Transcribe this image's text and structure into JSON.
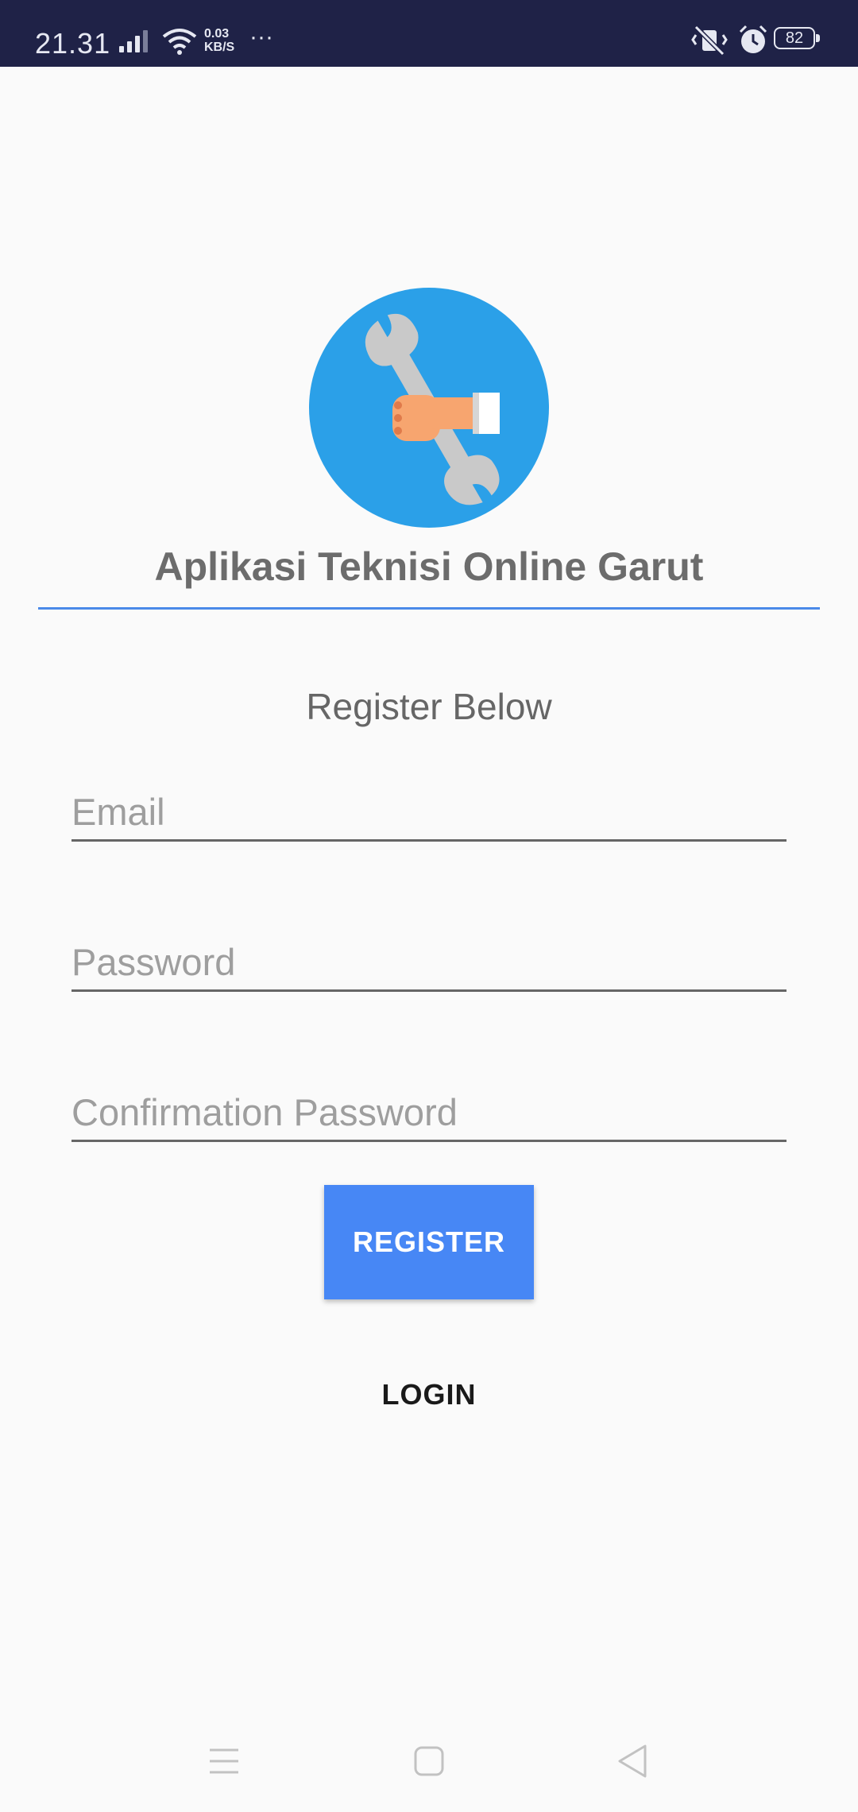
{
  "status_bar": {
    "time": "21.31",
    "net_speed_value": "0.03",
    "net_speed_unit": "KB/S",
    "more": "···",
    "battery": "82",
    "icons": [
      "signal-icon",
      "wifi-icon",
      "mute-icon",
      "alarm-icon",
      "battery-icon"
    ]
  },
  "header": {
    "logo_icon": "wrench-hand-logo",
    "title": "Aplikasi Teknisi Online Garut"
  },
  "form": {
    "heading": "Register Below",
    "email_placeholder": "Email",
    "password_placeholder": "Password",
    "confirm_placeholder": "Confirmation Password",
    "register_label": "REGISTER",
    "login_label": "LOGIN"
  },
  "nav_bar": {
    "icons": [
      "menu-icon",
      "home-icon",
      "back-icon"
    ]
  },
  "colors": {
    "status_bar_bg": "#1f2247",
    "logo_circle": "#2ba0e8",
    "accent_line": "#4a8ae8",
    "register_button": "#4787f5"
  }
}
